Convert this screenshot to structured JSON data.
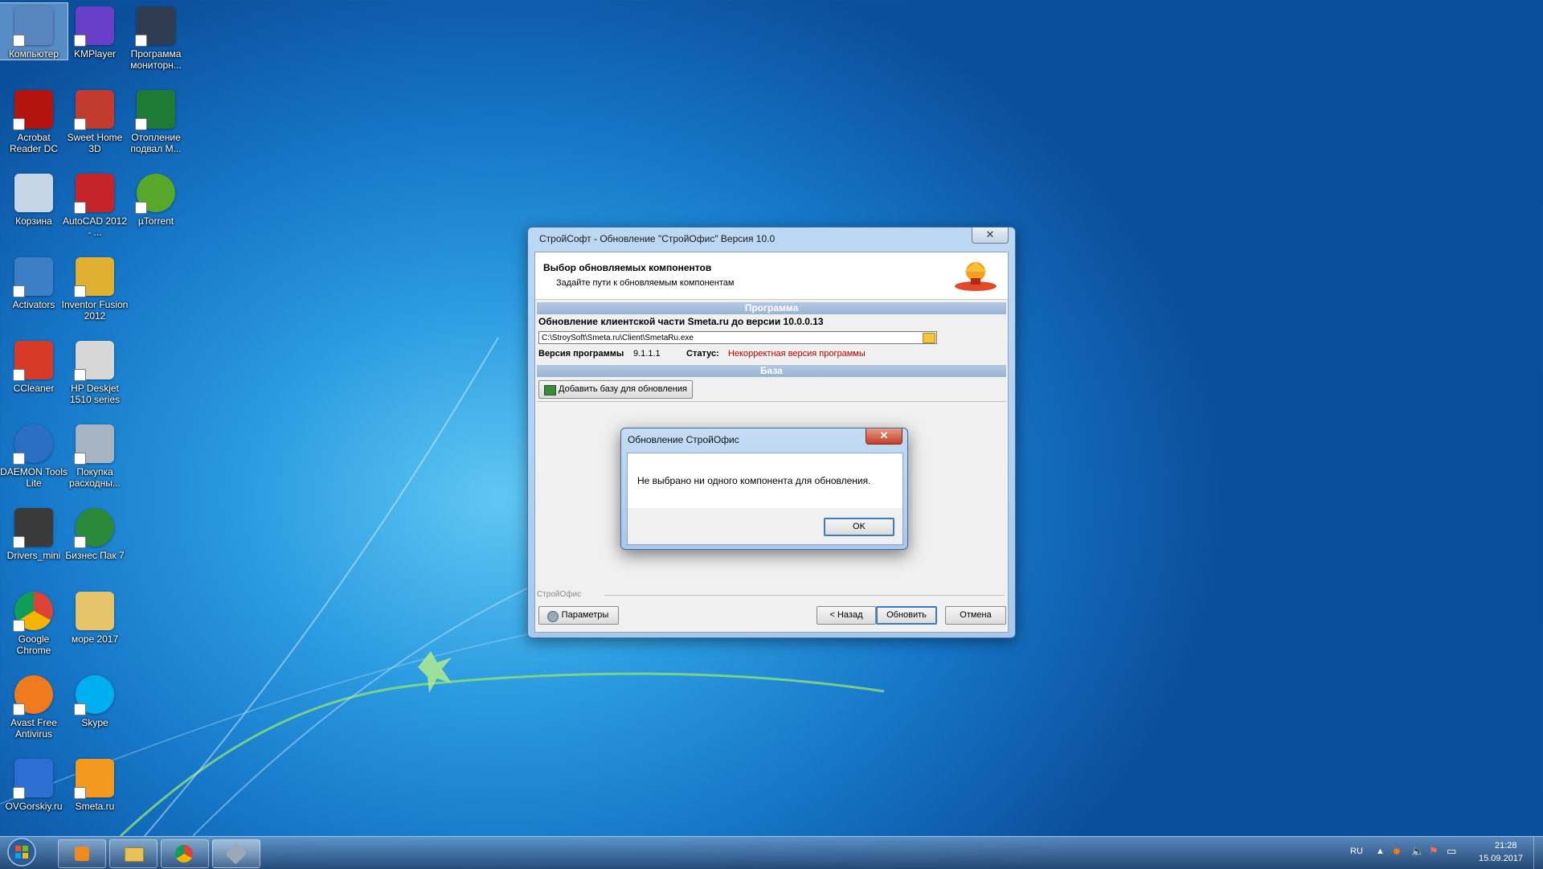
{
  "desktop": {
    "icons": [
      {
        "label": "Компьютер",
        "color": "#5a86c0"
      },
      {
        "label": "KMPlayer",
        "color": "#6a3fc8"
      },
      {
        "label": "Программа мониторн...",
        "color": "#2f3c52"
      },
      {
        "label": "Acrobat Reader DC",
        "color": "#b3140e"
      },
      {
        "label": "Sweet Home 3D",
        "color": "#c23b2e"
      },
      {
        "label": "Отопление подвал М...",
        "color": "#1f7a36"
      },
      {
        "label": "Корзина",
        "color": "#c7d6e6"
      },
      {
        "label": "AutoCAD 2012 - ...",
        "color": "#c4242a"
      },
      {
        "label": "µTorrent",
        "color": "#57a82a"
      },
      {
        "label": "Activators",
        "color": "#3d7fc7"
      },
      {
        "label": "Inventor Fusion 2012",
        "color": "#e0b030"
      },
      {
        "label": "CCleaner",
        "color": "#d83a2a"
      },
      {
        "label": "HP Deskjet 1510 series",
        "color": "#d7d7d7"
      },
      {
        "label": "DAEMON Tools Lite",
        "color": "#2b6fc5"
      },
      {
        "label": "Покупка расходны...",
        "color": "#a7b5c2"
      },
      {
        "label": "Drivers_mini",
        "color": "#3a3a3a"
      },
      {
        "label": "Бизнес Пак 7",
        "color": "#2a8a3a"
      },
      {
        "label": "Google Chrome",
        "color": "#db4437"
      },
      {
        "label": "море 2017",
        "color": "#e6c46a"
      },
      {
        "label": "Avast Free Antivirus",
        "color": "#f07a1e"
      },
      {
        "label": "Skype",
        "color": "#00aff0"
      },
      {
        "label": "OVGorskiy.ru",
        "color": "#2c6ed2"
      },
      {
        "label": "Smeta.ru",
        "color": "#f39a1e"
      }
    ]
  },
  "main_window": {
    "title": "СтройСофт - Обновление \"СтройОфис\" Версия 10.0",
    "close_glyph": "✕",
    "header_title": "Выбор обновляемых компонентов",
    "header_subtitle": "Задайте пути к обновляемым компонентам",
    "section_program": "Программа",
    "update_label": "Обновление клиентской части Smeta.ru до версии 10.0.0.13",
    "path_value": "C:\\StroySoft\\Smeta.ru\\Client\\SmetaRu.exe",
    "version_label": "Версия программы",
    "version_value": "9.1.1.1",
    "status_label": "Статус:",
    "status_value": "Некорректная версия программы",
    "section_base": "База",
    "add_base_button": "Добавить базу для обновления",
    "footer_group": "СтройОфис",
    "params_button": "Параметры",
    "back_button": "< Назад",
    "update_button": "Обновить",
    "cancel_button": "Отмена",
    "status_color": "#c00000"
  },
  "dialog": {
    "title": "Обновление СтройОфис",
    "close_glyph": "✕",
    "message": "Не выбрано ни одного компонента для обновления.",
    "ok_button": "OK"
  },
  "taskbar": {
    "language": "RU",
    "time": "21:28",
    "date": "15.09.2017",
    "buttons": [
      "media-player-icon",
      "explorer-icon",
      "chrome-icon",
      "stroysoft-updater-icon"
    ]
  }
}
